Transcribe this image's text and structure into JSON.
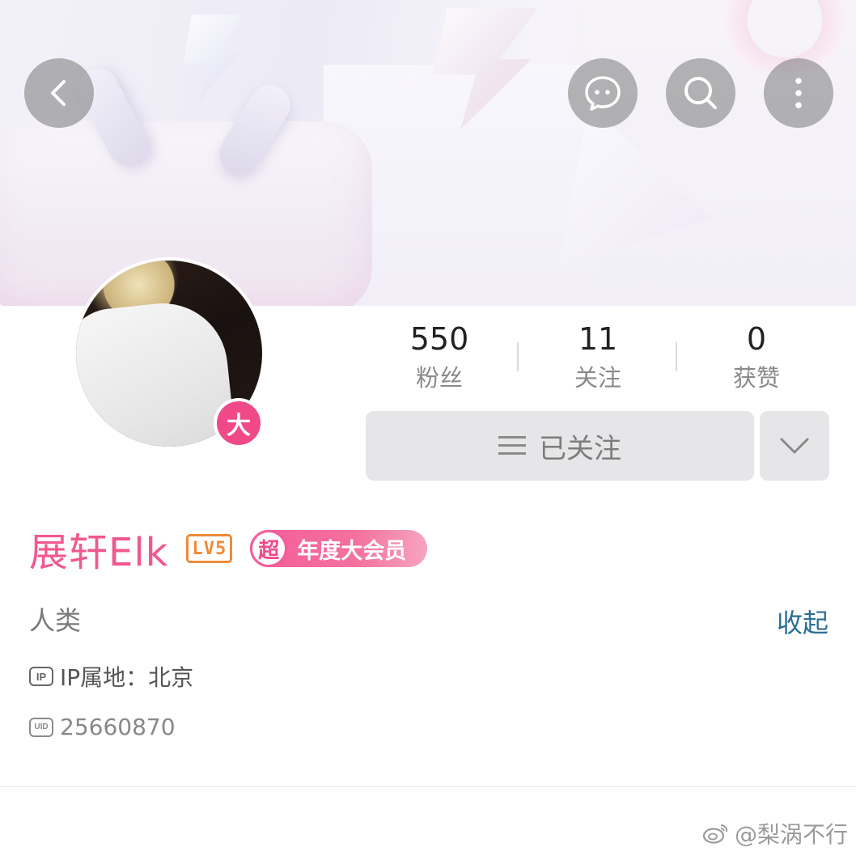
{
  "header": {
    "back_icon": "chevron-left-icon",
    "actions": [
      {
        "icon": "chat-icon"
      },
      {
        "icon": "search-icon"
      },
      {
        "icon": "more-vertical-icon"
      }
    ]
  },
  "profile": {
    "avatar_badge": "大",
    "name": "展轩Elk",
    "level": "LV5",
    "vip_badge_char": "超",
    "vip_label": "年度大会员",
    "bio": "人类",
    "collapse_label": "收起",
    "ip_label": "IP属地：北京",
    "ip_icon_text": "IP",
    "uid": "25660870",
    "uid_icon_text": "UID"
  },
  "stats": [
    {
      "value": "550",
      "label": "粉丝"
    },
    {
      "value": "11",
      "label": "关注"
    },
    {
      "value": "0",
      "label": "获赞"
    }
  ],
  "follow_button": {
    "label": "已关注",
    "icon": "menu-icon"
  },
  "dropdown_icon": "chevron-down-icon",
  "watermark": "@梨涡不行",
  "colors": {
    "name": "#f0598f",
    "level": "#f08a3a",
    "vip": "#f55c9a",
    "link": "#2a6f96",
    "button_bg": "#e6e6e8"
  }
}
